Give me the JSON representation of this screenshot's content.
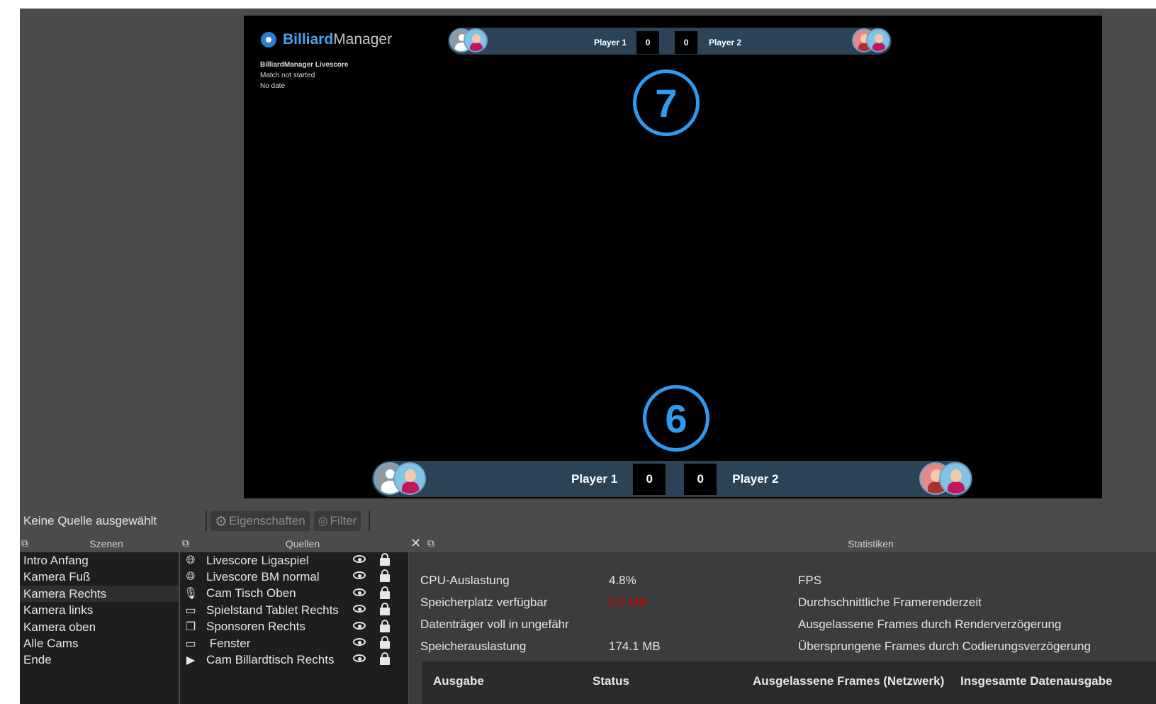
{
  "preview": {
    "brand_bold": "Billiard",
    "brand_light": "Manager",
    "info_title": "BilliardManager Livescore",
    "info_status": "Match not started",
    "info_date": "No date",
    "scoreboard_top": {
      "player1": "Player 1",
      "score1": "0",
      "score2": "0",
      "player2": "Player 2"
    },
    "scoreboard_bottom": {
      "player1": "Player 1",
      "score1": "0",
      "score2": "0",
      "player2": "Player 2"
    },
    "marker_top": "7",
    "marker_bottom": "6",
    "accent_color": "#2f9bf0"
  },
  "toolbar": {
    "no_source": "Keine Quelle ausgewählt",
    "properties": "Eigenschaften",
    "filter": "Filter"
  },
  "scenes": {
    "title": "Szenen",
    "items": [
      "Intro Anfang",
      "Kamera Fuß",
      "Kamera Rechts",
      "Kamera links",
      "Kamera oben",
      "Alle Cams",
      "Ende"
    ],
    "selected": "Kamera Rechts"
  },
  "sources": {
    "title": "Quellen",
    "items": [
      {
        "icon": "globe-icon",
        "name": "Livescore Ligaspiel"
      },
      {
        "icon": "globe-icon",
        "name": "Livescore BM normal"
      },
      {
        "icon": "microphone-icon",
        "name": "Cam Tisch Oben"
      },
      {
        "icon": "window-icon",
        "name": "Spielstand Tablet Rechts"
      },
      {
        "icon": "images-icon",
        "name": "Sponsoren Rechts"
      },
      {
        "icon": "window-icon",
        "name": " Fenster"
      },
      {
        "icon": "play-icon",
        "name": "Cam Billardtisch Rechts"
      }
    ]
  },
  "stats": {
    "title": "Statistiken",
    "cpu_label": "CPU-Auslastung",
    "cpu_value": "4.8%",
    "disk_label": "Speicherplatz verfügbar",
    "disk_value": "0.0 MB",
    "disk_value_color": "#cc0000",
    "full_label": "Datenträger voll in ungefähr",
    "mem_label": "Speicherauslastung",
    "mem_value": "174.1 MB",
    "fps_label": "FPS",
    "render_time_label": "Durchschnittliche Framerenderzeit",
    "dropped_render_label": "Ausgelassene Frames durch Renderverzögerung",
    "skipped_encode_label": "Übersprungene Frames durch Codierungsverzögerung",
    "table": {
      "col_output": "Ausgabe",
      "col_status": "Status",
      "col_dropped_net": "Ausgelassene Frames (Netzwerk)",
      "col_total": "Insgesamte Datenausgabe"
    }
  }
}
